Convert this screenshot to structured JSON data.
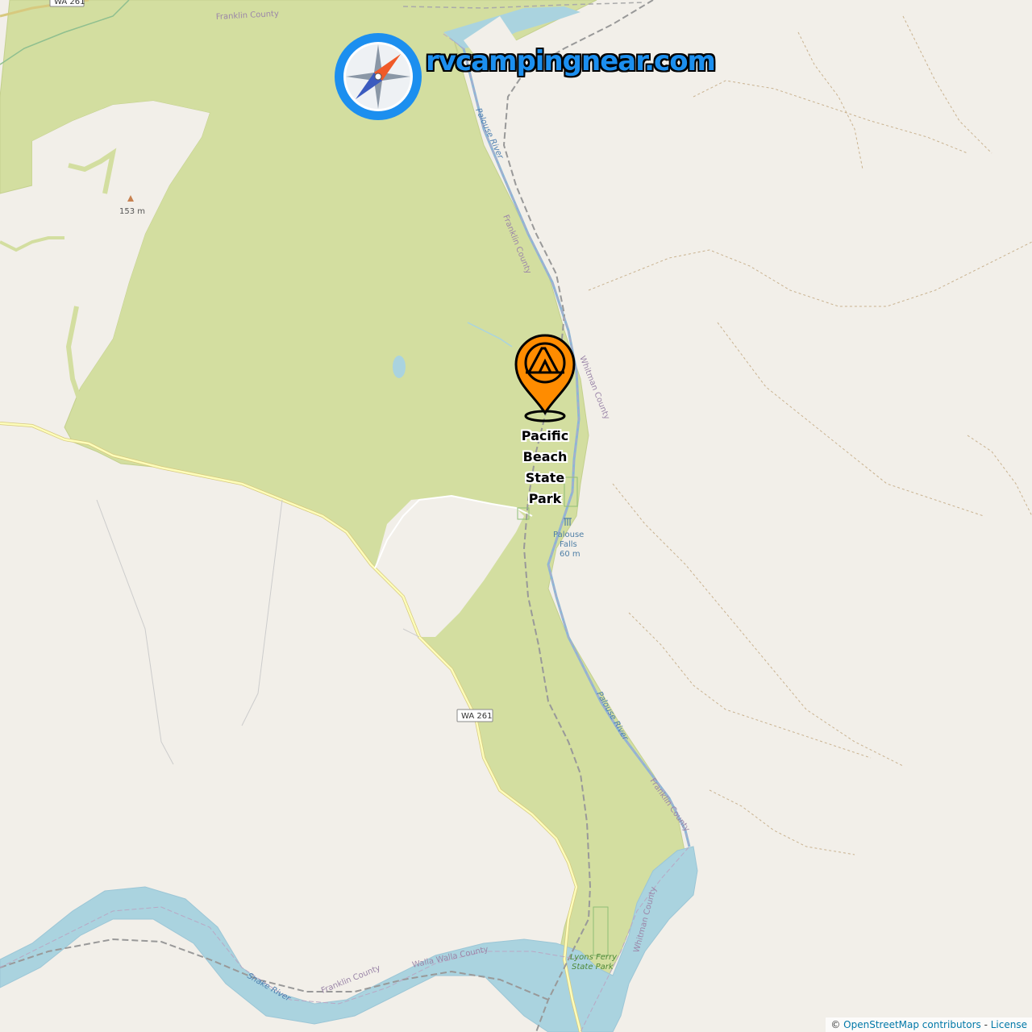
{
  "brand": {
    "text": "rvcampingnear.com",
    "icon": "compass-icon",
    "colors": {
      "text": "#1c8fef",
      "ring": "#1c8fef",
      "needle_north": "#f05a28",
      "needle_south": "#3b5bbf"
    }
  },
  "marker": {
    "icon": "campground-pin-icon",
    "label": "Pacific\nBeach\nState\nPark",
    "color": "#ff8c00"
  },
  "map_labels": {
    "road_wa261_top": "WA 261",
    "road_wa261": "WA 261",
    "franklin_county_top": "Franklin County",
    "franklin_county_mid": "Franklin County",
    "franklin_county_lower": "Franklin County",
    "franklin_county_bottom": "Franklin County",
    "whitman_county_mid": "Whitman County",
    "whitman_county_lower": "Whitman County",
    "walla_walla_county": "Walla Walla County",
    "palouse_river_top": "Palouse River",
    "palouse_river_lower": "Palouse River",
    "snake_river": "Snake River",
    "peak_elevation": "153 m",
    "falls_name_1": "Palouse",
    "falls_name_2": "Falls",
    "falls_height": "60 m",
    "lyons_ferry_1": "Lyons Ferry",
    "lyons_ferry_2": "State Park"
  },
  "colors": {
    "land": "#f2efe9",
    "park": "#d3dea0",
    "water": "#aad3df",
    "river_line": "#8bb6d6",
    "road": "#fdfdba",
    "county_border": "#b9a8c4"
  },
  "attribution": {
    "copyright": "©",
    "osm": "OpenStreetMap contributors",
    "separator": " - ",
    "license": "License"
  }
}
